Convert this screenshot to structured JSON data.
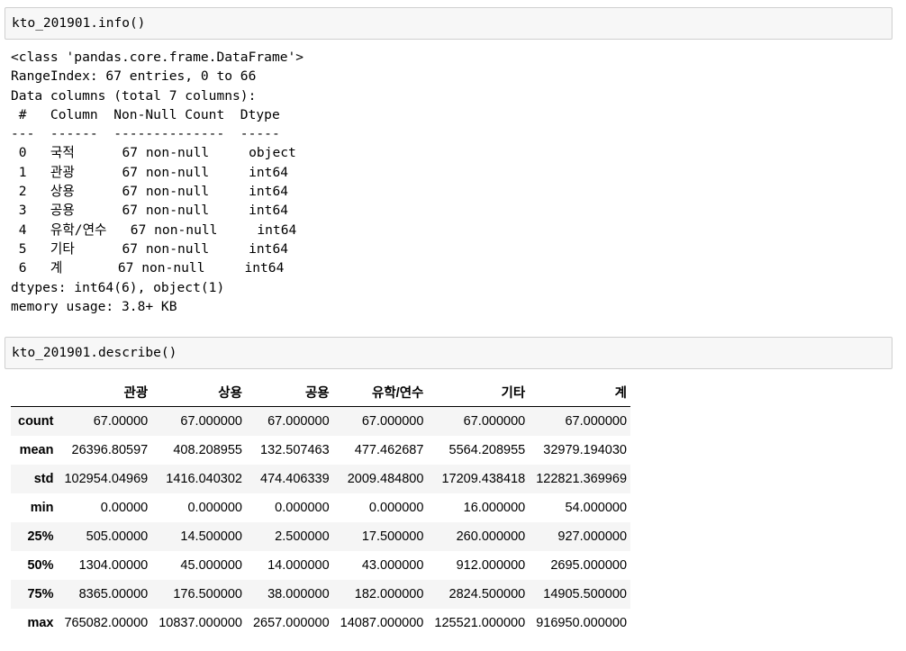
{
  "cells": [
    {
      "code": "kto_201901.info()",
      "output_lines": [
        "<class 'pandas.core.frame.DataFrame'>",
        "RangeIndex: 67 entries, 0 to 66",
        "Data columns (total 7 columns):",
        " #   Column  Non-Null Count  Dtype ",
        "---  ------  --------------  ----- ",
        " 0   국적      67 non-null     object",
        " 1   관광      67 non-null     int64 ",
        " 2   상용      67 non-null     int64 ",
        " 3   공용      67 non-null     int64 ",
        " 4   유학/연수   67 non-null     int64 ",
        " 5   기타      67 non-null     int64 ",
        " 6   계       67 non-null     int64 ",
        "dtypes: int64(6), object(1)",
        "memory usage: 3.8+ KB"
      ]
    },
    {
      "code": "kto_201901.describe()",
      "table": {
        "columns": [
          "",
          "관광",
          "상용",
          "공용",
          "유학/연수",
          "기타",
          "계"
        ],
        "rows": [
          {
            "label": "count",
            "values": [
              "67.00000",
              "67.000000",
              "67.000000",
              "67.000000",
              "67.000000",
              "67.000000"
            ]
          },
          {
            "label": "mean",
            "values": [
              "26396.80597",
              "408.208955",
              "132.507463",
              "477.462687",
              "5564.208955",
              "32979.194030"
            ]
          },
          {
            "label": "std",
            "values": [
              "102954.04969",
              "1416.040302",
              "474.406339",
              "2009.484800",
              "17209.438418",
              "122821.369969"
            ]
          },
          {
            "label": "min",
            "values": [
              "0.00000",
              "0.000000",
              "0.000000",
              "0.000000",
              "16.000000",
              "54.000000"
            ]
          },
          {
            "label": "25%",
            "values": [
              "505.00000",
              "14.500000",
              "2.500000",
              "17.500000",
              "260.000000",
              "927.000000"
            ]
          },
          {
            "label": "50%",
            "values": [
              "1304.00000",
              "45.000000",
              "14.000000",
              "43.000000",
              "912.000000",
              "2695.000000"
            ]
          },
          {
            "label": "75%",
            "values": [
              "8365.00000",
              "176.500000",
              "38.000000",
              "182.000000",
              "2824.500000",
              "14905.500000"
            ]
          },
          {
            "label": "max",
            "values": [
              "765082.00000",
              "10837.000000",
              "2657.000000",
              "14087.000000",
              "125521.000000",
              "916950.000000"
            ]
          }
        ]
      }
    }
  ]
}
